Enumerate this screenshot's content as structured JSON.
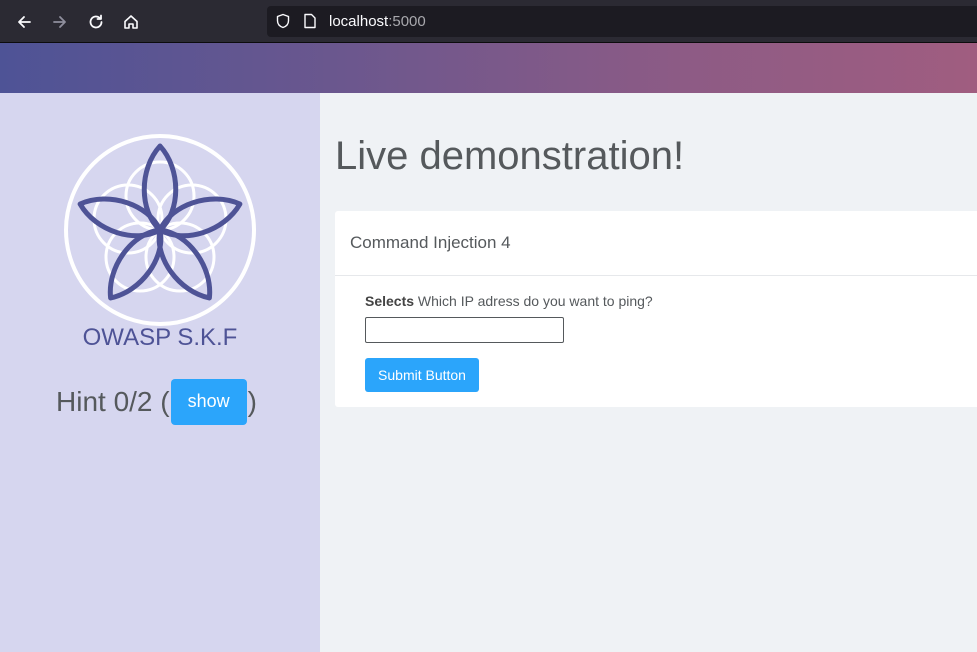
{
  "browser": {
    "url_host": "localhost",
    "url_port": ":5000",
    "icons": [
      "back-arrow-icon",
      "forward-arrow-icon",
      "reload-icon",
      "home-icon",
      "shield-icon",
      "page-icon"
    ]
  },
  "sidebar": {
    "brand": "OWASP S.K.F",
    "hint_prefix": "Hint 0/2 (",
    "hint_suffix": ")",
    "show_label": "show"
  },
  "main": {
    "title": "Live demonstration!",
    "card_title": "Command Injection 4",
    "field_label_bold": "Selects",
    "field_label_text": " Which IP adress do you want to ping?",
    "input_value": "",
    "submit_label": "Submit Button"
  },
  "colors": {
    "accent": "#2ba5fb",
    "brand": "#4e5396",
    "sidebar_bg": "#d6d6ef"
  }
}
